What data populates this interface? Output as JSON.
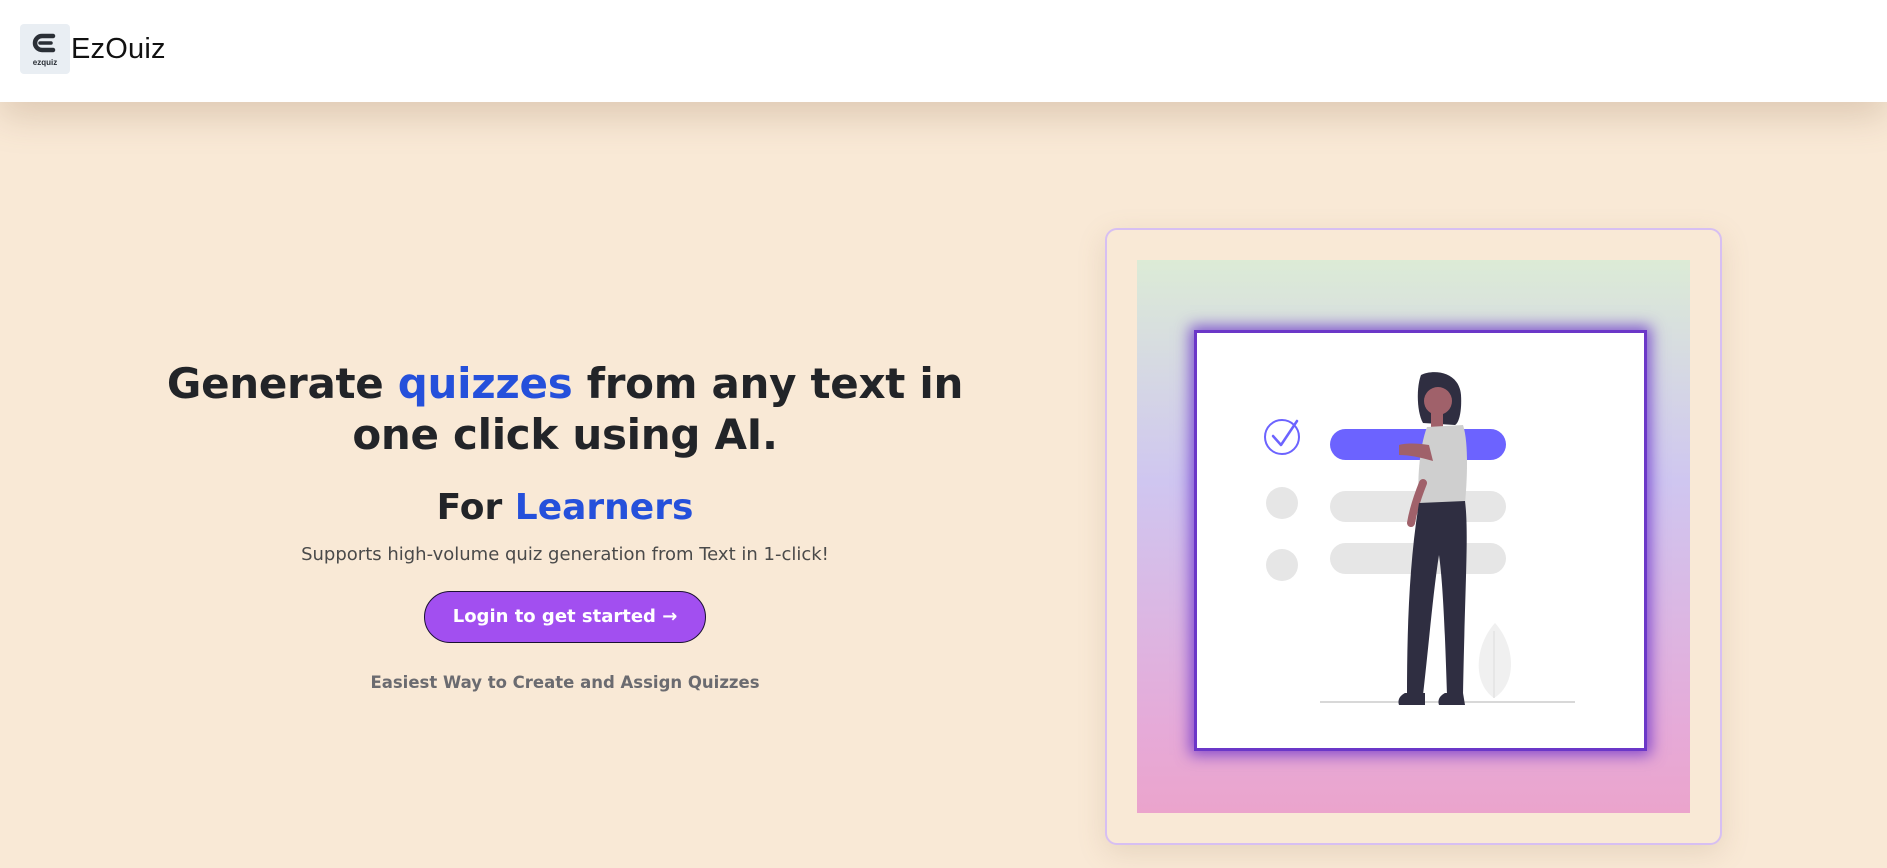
{
  "navbar": {
    "logo_small_text": "ezquiz",
    "brand_name": "EzOuiz"
  },
  "hero": {
    "headline_part1": "Generate ",
    "headline_accent": "quizzes",
    "headline_part2": " from any text in one click using AI.",
    "subhead_prefix": "For ",
    "subhead_accent": "Learners",
    "support_text": "Supports high-volume quiz generation from Text in 1-click!",
    "cta_label": "Login to get started →",
    "tagline": "Easiest Way to Create and Assign Quizzes"
  },
  "colors": {
    "background": "#f9e9d6",
    "accent_blue": "#2550db",
    "cta_purple": "#a24ff0",
    "illustration_purple": "#6c63ff"
  },
  "icons": [
    "logo-icon",
    "checkmark-circle-icon",
    "leaf-icon",
    "person-illustration"
  ]
}
